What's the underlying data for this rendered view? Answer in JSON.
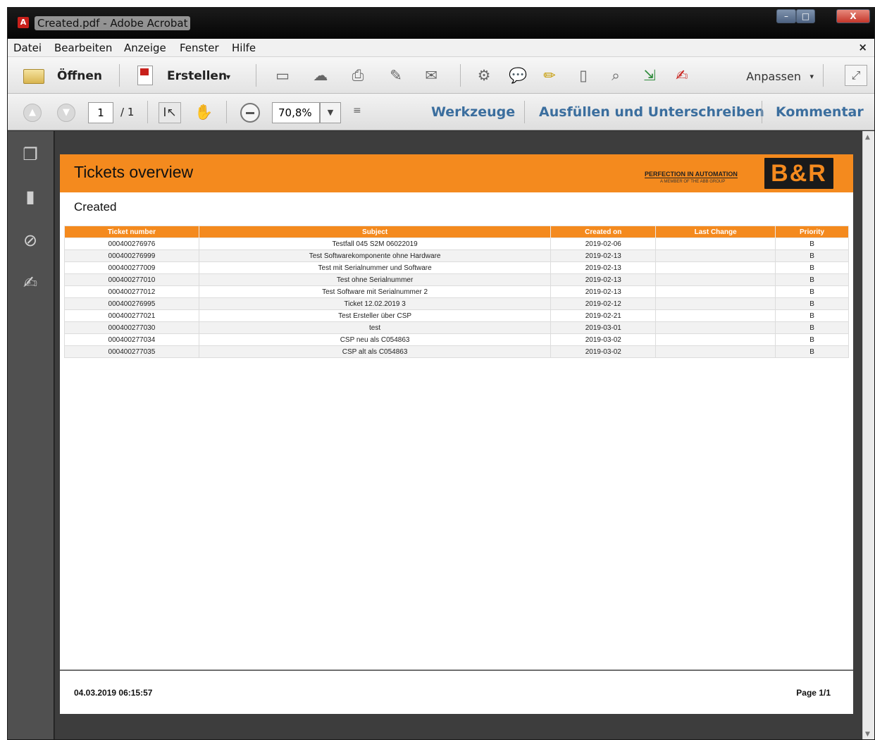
{
  "window": {
    "title": "Created.pdf - Adobe Acrobat",
    "app_icon": "pdf-icon",
    "controls": {
      "minimize": "–",
      "maximize": "□",
      "close": "X"
    }
  },
  "menu": {
    "items": [
      "Datei",
      "Bearbeiten",
      "Anzeige",
      "Fenster",
      "Hilfe"
    ],
    "close_doc": "×"
  },
  "toolbar1": {
    "open_label": "Öffnen",
    "create_label": "Erstellen",
    "dropdown_arrow": "▾",
    "customize_label": "Anpassen",
    "icons": [
      "save-icon",
      "cloud-upload-icon",
      "print-icon",
      "edit-document-icon",
      "email-icon",
      "settings-gear-icon",
      "comment-icon",
      "highlight-text-icon",
      "attach-file-icon",
      "search-document-icon",
      "export-document-icon",
      "sign-document-icon"
    ]
  },
  "toolbar2": {
    "page_current": "1",
    "page_total": "/ 1",
    "zoom_value": "70,8%",
    "links": {
      "tools": "Werkzeuge",
      "fill_sign": "Ausfüllen und Unterschreiben",
      "comment": "Kommentar"
    }
  },
  "sidebar": {
    "icons": [
      "pages-icon",
      "bookmark-icon",
      "attachment-icon",
      "signature-icon"
    ]
  },
  "report": {
    "title": "Tickets overview",
    "tagline": "PERFECTION IN AUTOMATION",
    "subtagline": "A MEMBER OF THE ABB GROUP",
    "logo_text": "B&R",
    "subtitle": "Created",
    "columns": [
      "Ticket number",
      "Subject",
      "Created on",
      "Last Change",
      "Priority"
    ],
    "rows": [
      [
        "000400276976",
        "Testfall 045 S2M 06022019",
        "2019-02-06",
        "",
        "B"
      ],
      [
        "000400276999",
        "Test Softwarekomponente ohne Hardware",
        "2019-02-13",
        "",
        "B"
      ],
      [
        "000400277009",
        "Test mit Serialnummer und Software",
        "2019-02-13",
        "",
        "B"
      ],
      [
        "000400277010",
        "Test ohne Serialnummer",
        "2019-02-13",
        "",
        "B"
      ],
      [
        "000400277012",
        "Test Software mit Serialnummer 2",
        "2019-02-13",
        "",
        "B"
      ],
      [
        "000400276995",
        "Ticket 12.02.2019 3",
        "2019-02-12",
        "",
        "B"
      ],
      [
        "000400277021",
        "Test Ersteller über CSP",
        "2019-02-21",
        "",
        "B"
      ],
      [
        "000400277030",
        "test",
        "2019-03-01",
        "",
        "B"
      ],
      [
        "000400277034",
        "CSP neu als C054863",
        "2019-03-02",
        "",
        "B"
      ],
      [
        "000400277035",
        "CSP alt als C054863",
        "2019-03-02",
        "",
        "B"
      ]
    ],
    "footer_date": "04.03.2019 06:15:57",
    "footer_page": "Page 1/1"
  },
  "colors": {
    "accent_orange": "#f48a1e",
    "link_blue": "#3b6e9e",
    "sidebar_gray": "#505050",
    "doc_background": "#3d3d3d"
  }
}
